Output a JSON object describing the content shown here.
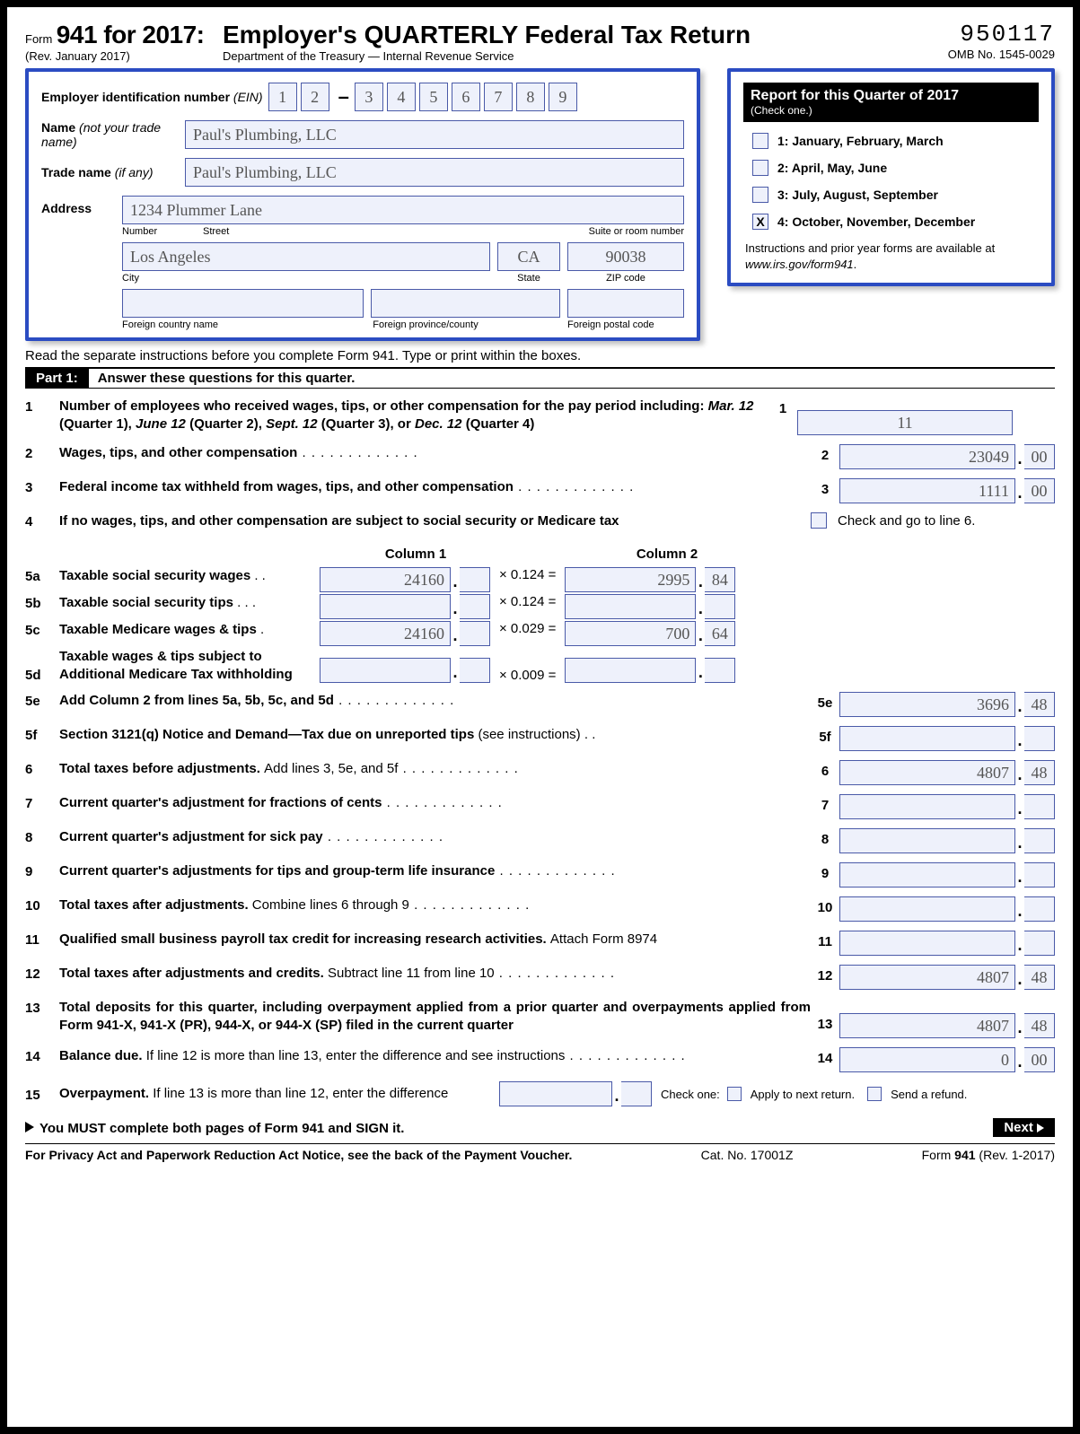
{
  "header": {
    "form_word": "Form",
    "form_num": "941 for 2017:",
    "rev": "(Rev. January 2017)",
    "title": "Employer's QUARTERLY Federal Tax Return",
    "dept": "Department of the Treasury — Internal Revenue Service",
    "code": "950117",
    "omb": "OMB No. 1545-0029"
  },
  "ein": {
    "label": "Employer identification number",
    "abbr": "(EIN)",
    "d1": "1",
    "d2": "2",
    "d3": "3",
    "d4": "4",
    "d5": "5",
    "d6": "6",
    "d7": "7",
    "d8": "8",
    "d9": "9"
  },
  "name": {
    "label": "Name",
    "hint": "(not your trade name)",
    "value": "Paul's Plumbing, LLC"
  },
  "trade": {
    "label": "Trade name",
    "hint": "(if any)",
    "value": "Paul's Plumbing, LLC"
  },
  "address": {
    "label": "Address",
    "street": "1234 Plummer Lane",
    "sub_number": "Number",
    "sub_street": "Street",
    "sub_suite": "Suite or room number",
    "city": "Los Angeles",
    "state": "CA",
    "zip": "90038",
    "sub_city": "City",
    "sub_state": "State",
    "sub_zip": "ZIP code",
    "sub_fcountry": "Foreign country name",
    "sub_fprov": "Foreign province/county",
    "sub_fpost": "Foreign postal code"
  },
  "quarter": {
    "title": "Report for this Quarter of 2017",
    "check": "(Check one.)",
    "opt1": "1: January, February, March",
    "opt2": "2: April, May, June",
    "opt3": "3: July, August, September",
    "opt4": "4: October, November, December",
    "x": "X",
    "note1": "Instructions and prior year forms are available at ",
    "note2": "www.irs.gov/form941",
    "note3": "."
  },
  "instr": "Read the separate instructions before you complete Form 941. Type or print within the boxes.",
  "part1": {
    "tag": "Part 1:",
    "txt": "Answer these questions for this quarter."
  },
  "lines": {
    "l1": {
      "n": "1",
      "txt_a": "Number of employees who received wages, tips, or other compensation for the pay period including: ",
      "it1": "Mar. 12",
      "p1": " (Quarter 1), ",
      "it2": "June 12",
      "p2": " (Quarter 2), ",
      "it3": "Sept. 12",
      "p3": " (Quarter 3), or ",
      "it4": "Dec. 12",
      "p4": " (Quarter 4)",
      "rn": "1",
      "val": "11"
    },
    "l2": {
      "n": "2",
      "txt": "Wages, tips, and other compensation",
      "rn": "2",
      "d": "23049",
      "c": "00"
    },
    "l3": {
      "n": "3",
      "txt": "Federal income tax withheld from wages, tips, and other compensation",
      "rn": "3",
      "d": "1111",
      "c": "00"
    },
    "l4": {
      "n": "4",
      "txt": "If no wages, tips, and other compensation are subject to social security or Medicare tax",
      "chk": "Check and go to line 6."
    },
    "col1": "Column 1",
    "col2": "Column 2",
    "l5a": {
      "n": "5a",
      "txt": "Taxable social security wages",
      "c1": "24160",
      "m": "× 0.124 =",
      "c2d": "2995",
      "c2c": "84"
    },
    "l5b": {
      "n": "5b",
      "txt": "Taxable social security tips",
      "c1": "",
      "m": "× 0.124 =",
      "c2d": "",
      "c2c": ""
    },
    "l5c": {
      "n": "5c",
      "txt": "Taxable Medicare wages & tips",
      "c1": "24160",
      "m": "× 0.029 =",
      "c2d": "700",
      "c2c": "64"
    },
    "l5d": {
      "n": "5d",
      "txt1": "Taxable wages & tips subject to",
      "txt2": "Additional Medicare Tax withholding",
      "c1": "",
      "m": "× 0.009 =",
      "c2d": "",
      "c2c": ""
    },
    "l5e": {
      "n": "5e",
      "txt": "Add Column 2 from lines 5a, 5b, 5c, and 5d",
      "rn": "5e",
      "d": "3696",
      "c": "48"
    },
    "l5f": {
      "n": "5f",
      "txt": "Section 3121(q) Notice and Demand—Tax due on unreported tips ",
      "hint": "(see instructions)",
      "rn": "5f",
      "d": "",
      "c": ""
    },
    "l6": {
      "n": "6",
      "txt": "Total taxes before adjustments. ",
      "reg": "Add lines 3, 5e, and 5f",
      "rn": "6",
      "d": "4807",
      "c": "48"
    },
    "l7": {
      "n": "7",
      "txt": "Current quarter's adjustment for fractions of cents",
      "rn": "7",
      "d": "",
      "c": ""
    },
    "l8": {
      "n": "8",
      "txt": "Current quarter's adjustment for sick pay",
      "rn": "8",
      "d": "",
      "c": ""
    },
    "l9": {
      "n": "9",
      "txt": "Current quarter's adjustments for tips and group-term life insurance",
      "rn": "9",
      "d": "",
      "c": ""
    },
    "l10": {
      "n": "10",
      "txt": "Total taxes after adjustments. ",
      "reg": "Combine lines 6 through 9",
      "rn": "10",
      "d": "",
      "c": ""
    },
    "l11": {
      "n": "11",
      "txt": "Qualified small business payroll tax credit for increasing research activities. ",
      "reg": "Attach Form 8974",
      "rn": "11",
      "d": "",
      "c": ""
    },
    "l12": {
      "n": "12",
      "txt": "Total taxes after adjustments and credits. ",
      "reg": "Subtract line 11 from line 10",
      "rn": "12",
      "d": "4807",
      "c": "48"
    },
    "l13": {
      "n": "13",
      "txt": "Total deposits for this quarter, including overpayment applied from a prior quarter and overpayments applied from Form 941-X, 941-X (PR), 944-X, or 944-X (SP) filed in the current quarter",
      "rn": "13",
      "d": "4807",
      "c": "48"
    },
    "l14": {
      "n": "14",
      "txt": "Balance due. ",
      "reg": "If line 12 is more than line 13, enter the difference and see instructions",
      "rn": "14",
      "d": "0",
      "c": "00"
    },
    "l15": {
      "n": "15",
      "txt": "Overpayment. ",
      "reg": "If line 13 is more than line 12, enter the difference",
      "d": "",
      "c": "",
      "co": "Check one:",
      "o1": "Apply to next return.",
      "o2": "Send a refund."
    }
  },
  "must": "You MUST complete both pages of Form 941 and SIGN it.",
  "next": "Next",
  "foot": {
    "l": "For Privacy Act and Paperwork Reduction Act Notice, see the back of the Payment Voucher.",
    "m": "Cat. No. 17001Z",
    "r1": "Form ",
    "r2": "941",
    "r3": " (Rev. 1-2017)"
  }
}
